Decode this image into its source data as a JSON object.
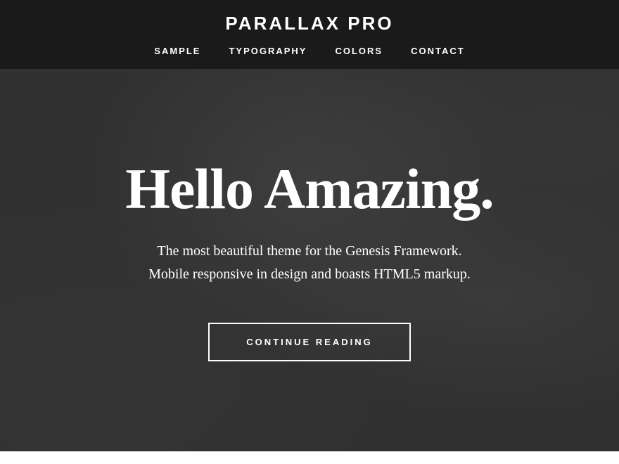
{
  "header": {
    "site_title": "PARALLAX PRO",
    "nav": {
      "items": [
        {
          "id": "sample",
          "label": "SAMPLE"
        },
        {
          "id": "typography",
          "label": "TYPOGRAPHY"
        },
        {
          "id": "colors",
          "label": "COLORS"
        },
        {
          "id": "contact",
          "label": "CONTACT"
        }
      ]
    }
  },
  "hero": {
    "heading": "Hello Amazing.",
    "subtext_line1": "The most beautiful theme for the Genesis Framework.",
    "subtext_line2": "Mobile responsive in design and boasts HTML5 markup.",
    "cta_label": "CONTINUE READING"
  }
}
